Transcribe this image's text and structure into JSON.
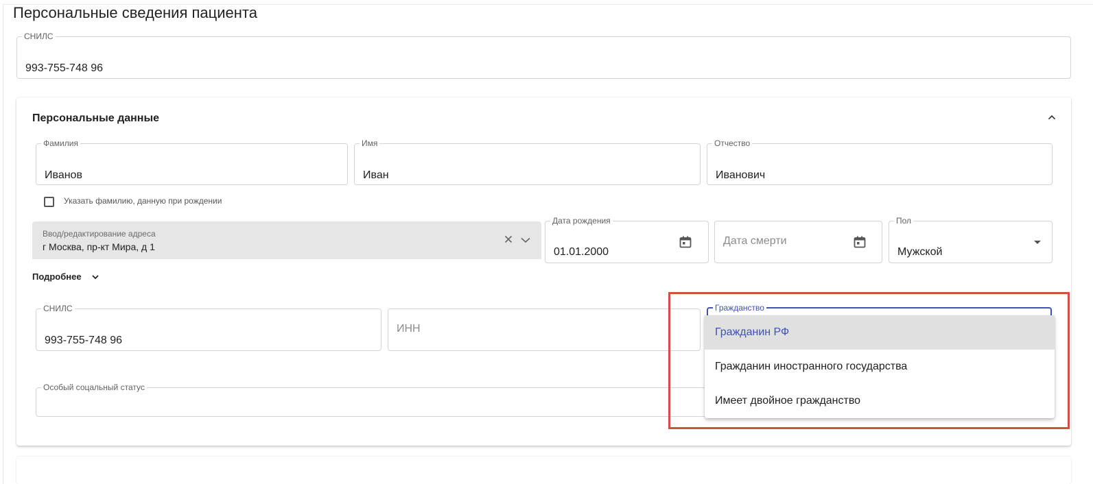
{
  "page": {
    "title": "Персональные сведения пациента"
  },
  "top_snils": {
    "label": "СНИЛС",
    "value": "993-755-748 96"
  },
  "personal": {
    "section_title": "Персональные данные",
    "collapse_icon": "chevron-up-icon",
    "last_name": {
      "label": "Фамилия",
      "value": "Иванов"
    },
    "first_name": {
      "label": "Имя",
      "value": "Иван"
    },
    "patronymic": {
      "label": "Отчество",
      "value": "Иванович"
    },
    "birth_surname_checkbox": {
      "label": "Указать фамилию, данную при рождении",
      "checked": false
    },
    "address": {
      "label": "Ввод/редактирование адреса",
      "value": "г Москва, пр-кт Мира, д 1"
    },
    "birth_date": {
      "label": "Дата рождения",
      "value": "01.01.2000"
    },
    "death_date": {
      "placeholder": "Дата смерти"
    },
    "gender": {
      "label": "Пол",
      "value": "Мужской"
    },
    "more_label": "Подробнее",
    "snils": {
      "label": "СНИЛС",
      "value": "993-755-748 96"
    },
    "inn": {
      "placeholder": "ИНН"
    },
    "citizenship": {
      "label": "Гражданство",
      "options": [
        "Гражданин РФ",
        "Гражданин иностранного государства",
        "Имеет двойное гражданство"
      ],
      "highlighted_index": 0
    },
    "social_status": {
      "label": "Особый соцальный статус"
    }
  },
  "colors": {
    "accent": "#3f51b5",
    "highlight_frame": "#d0513f",
    "selected_option_bg": "#e0e0e0"
  }
}
